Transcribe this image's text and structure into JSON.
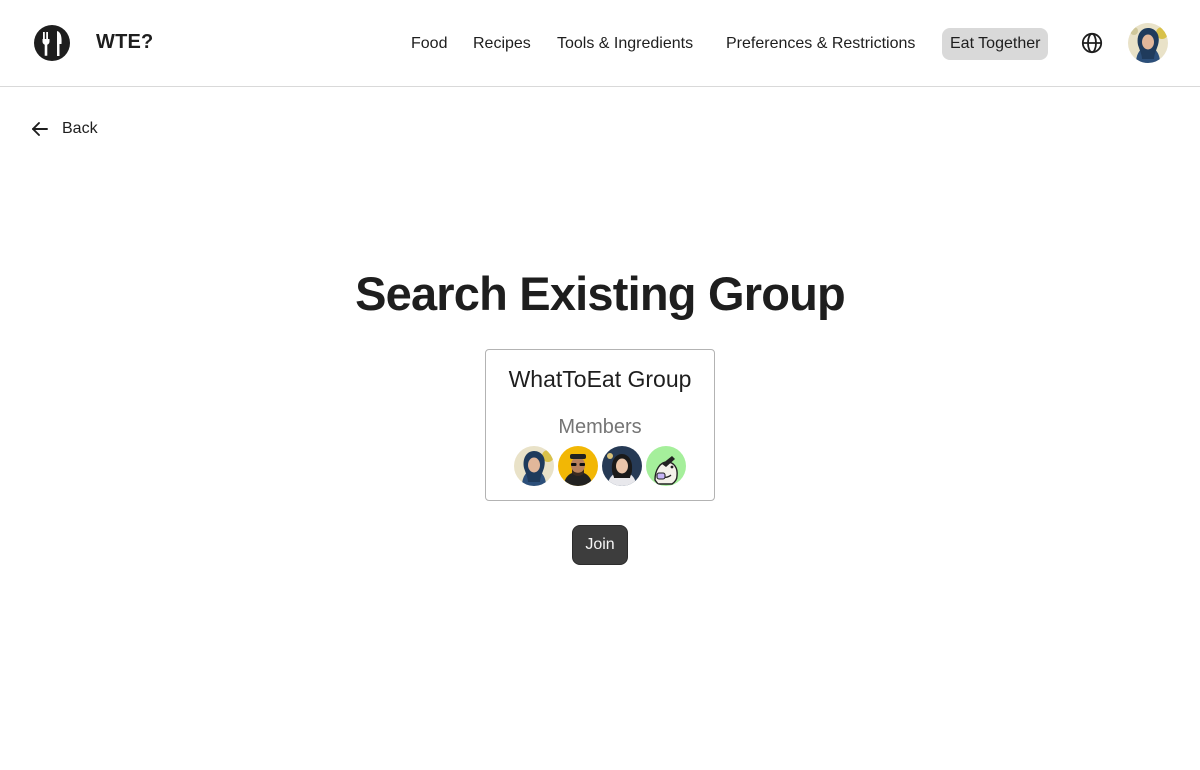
{
  "header": {
    "brand": "WTE?",
    "logo_icon": "fork-knife-logo-icon",
    "nav": [
      {
        "label": "Food",
        "active": false
      },
      {
        "label": "Recipes",
        "active": false
      },
      {
        "label": "Tools & Ingredients",
        "active": false
      },
      {
        "label": "Preferences & Restrictions",
        "active": false
      },
      {
        "label": "Eat Together",
        "active": true
      }
    ],
    "globe_icon": "globe-icon",
    "avatar": "user-avatar"
  },
  "back": {
    "label": "Back",
    "icon": "arrow-left-icon"
  },
  "main": {
    "title": "Search Existing Group",
    "group": {
      "name": "WhatToEat Group",
      "members_label": "Members",
      "members": [
        "member-1-avatar",
        "member-2-avatar",
        "member-3-avatar",
        "member-4-avatar"
      ]
    },
    "join_label": "Join"
  },
  "colors": {
    "text": "#1e1e1e",
    "muted": "#757575",
    "active_nav_bg": "#d9d9d9",
    "button_bg": "#3d3d3d",
    "card_border": "#b3b3b3"
  }
}
